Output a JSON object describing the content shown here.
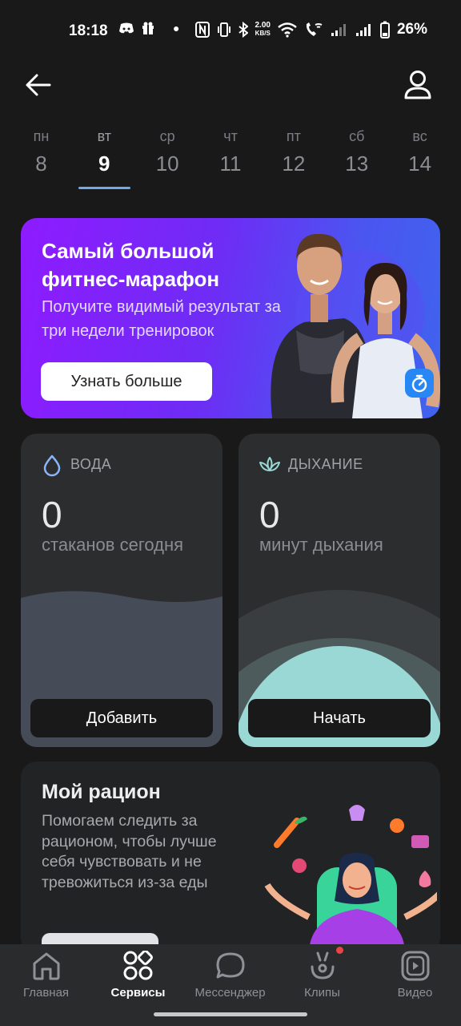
{
  "status": {
    "time": "18:18",
    "speed_top": "2.00",
    "speed_unit": "KB/S",
    "battery": "26%"
  },
  "days": [
    {
      "dw": "пн",
      "dn": "8"
    },
    {
      "dw": "вт",
      "dn": "9"
    },
    {
      "dw": "ср",
      "dn": "10"
    },
    {
      "dw": "чт",
      "dn": "11"
    },
    {
      "dw": "пт",
      "dn": "12"
    },
    {
      "dw": "сб",
      "dn": "13"
    },
    {
      "dw": "вс",
      "dn": "14"
    }
  ],
  "banner": {
    "title": "Самый большой фитнес-марафон",
    "subtitle": "Получите видимый результат за три недели тренировок",
    "button": "Узнать больше"
  },
  "water": {
    "label": "ВОДА",
    "value": "0",
    "unit": "стаканов сегодня",
    "button": "Добавить"
  },
  "breath": {
    "label": "ДЫХАНИЕ",
    "value": "0",
    "unit": "минут дыхания",
    "button": "Начать"
  },
  "diet": {
    "title": "Мой рацион",
    "description": "Помогаем следить за рационом, чтобы лучше себя чувствовать и не тревожиться из-за еды"
  },
  "nav": [
    {
      "label": "Главная"
    },
    {
      "label": "Сервисы"
    },
    {
      "label": "Мессенджер"
    },
    {
      "label": "Клипы"
    },
    {
      "label": "Видео"
    }
  ],
  "colors": {
    "accent": "#71aaeb",
    "background": "#19191a",
    "card": "#2c2d2e",
    "breath_accent": "#9ad8d6"
  }
}
